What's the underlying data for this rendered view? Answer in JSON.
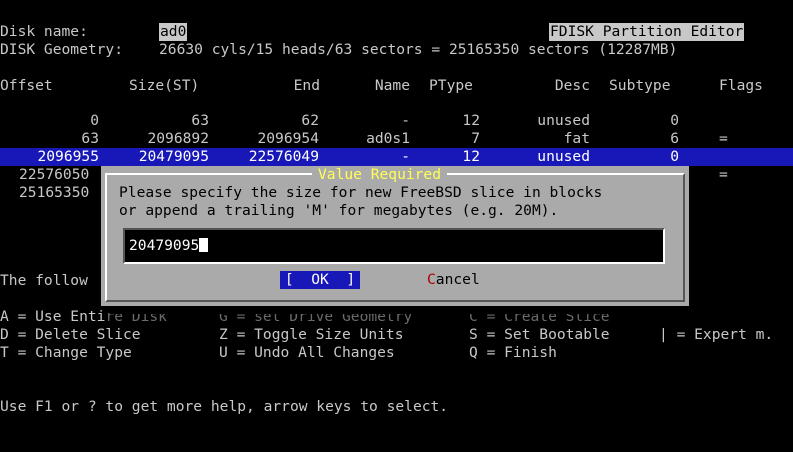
{
  "header": {
    "disk_label": "Disk name:",
    "disk_name": "ad0",
    "editor_title": "FDISK Partition Editor",
    "geometry_label": "DISK Geometry:",
    "geometry_value": "26630 cyls/15 heads/63 sectors = 25165350 sectors (12287MB)"
  },
  "table": {
    "columns": [
      "Offset",
      "Size(ST)",
      "End",
      "Name",
      "PType",
      "Desc",
      "Subtype",
      "Flags"
    ],
    "rows": [
      {
        "offset": "0",
        "size": "63",
        "end": "62",
        "name": "-",
        "ptype": "12",
        "desc": "unused",
        "subtype": "0",
        "flags": ""
      },
      {
        "offset": "63",
        "size": "2096892",
        "end": "2096954",
        "name": "ad0s1",
        "ptype": "7",
        "desc": "fat",
        "subtype": "6",
        "flags": "="
      },
      {
        "offset": "2096955",
        "size": "20479095",
        "end": "22576049",
        "name": "-",
        "ptype": "12",
        "desc": "unused",
        "subtype": "0",
        "flags": ""
      },
      {
        "offset": "22576050",
        "flags": "="
      },
      {
        "offset": "25165350"
      }
    ]
  },
  "footer": {
    "follow_text": "The follow",
    "cmd_a1": "A = Use Enti",
    "cmd_a2": "re Disk",
    "cmd_g": "G = set Drive Geometry",
    "cmd_c": "C = Create Slice",
    "cmd_d": "D = Delete Slice",
    "cmd_z": "Z = Toggle Size Units",
    "cmd_s": "S = Set Bootable",
    "cmd_pipe": "| = Expert m.",
    "cmd_t": "T = Change Type",
    "cmd_u": "U = Undo All Changes",
    "cmd_q": "Q = Finish",
    "help": "Use F1 or ? to get more help, arrow keys to select."
  },
  "dialog": {
    "title": "Value Required",
    "line1": "Please specify the size for new FreeBSD slice in blocks",
    "line2": "or append a trailing 'M' for megabytes (e.g. 20M).",
    "input_value": "20479095",
    "ok_label": "[  OK  ]",
    "cancel_hotkey": "C",
    "cancel_rest": "ancel"
  },
  "colors": {
    "background": "#000000",
    "text": "#c8c8c8",
    "selection": "#1818b8",
    "dialog_bg": "#aaaaaa",
    "dialog_title": "#ffff55",
    "hotkey": "#aa0000"
  }
}
